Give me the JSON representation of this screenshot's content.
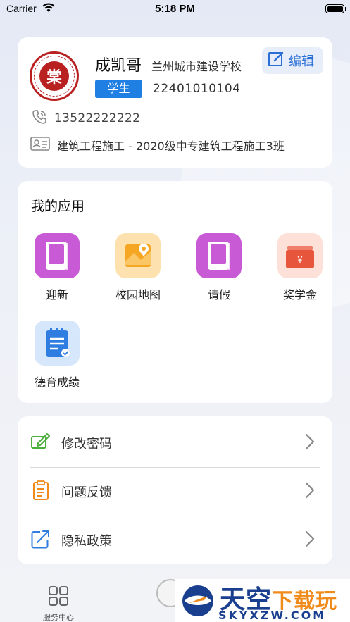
{
  "status_bar": {
    "carrier": "Carrier",
    "time": "5:18 PM"
  },
  "profile": {
    "logo_text": "棠",
    "name": "成凯哥",
    "school": "兰州城市建设学校",
    "edit_label": "编辑",
    "role_badge": "学生",
    "student_id": "22401010104",
    "phone": "13522222222",
    "class_info": "建筑工程施工 - 2020级中专建筑工程施工3班"
  },
  "apps": {
    "title": "我的应用",
    "items": [
      {
        "label": "迎新",
        "icon": "book-icon",
        "color": "#c85ad6"
      },
      {
        "label": "校园地图",
        "icon": "map-icon",
        "color": "#f5a623"
      },
      {
        "label": "请假",
        "icon": "book-icon",
        "color": "#c85ad6"
      },
      {
        "label": "奖学金",
        "icon": "wallet-icon",
        "color": "#e8553d"
      },
      {
        "label": "德育成绩",
        "icon": "report-icon",
        "color": "#2f7de1"
      }
    ]
  },
  "menu": {
    "items": [
      {
        "label": "修改密码",
        "icon": "edit-password-icon"
      },
      {
        "label": "问题反馈",
        "icon": "clipboard-icon"
      },
      {
        "label": "隐私政策",
        "icon": "privacy-icon"
      }
    ]
  },
  "tabbar": {
    "service_label": "服务中心"
  },
  "watermark": {
    "main": "天空",
    "accent": "下载玩",
    "sub": "SKYXZW.COM"
  }
}
